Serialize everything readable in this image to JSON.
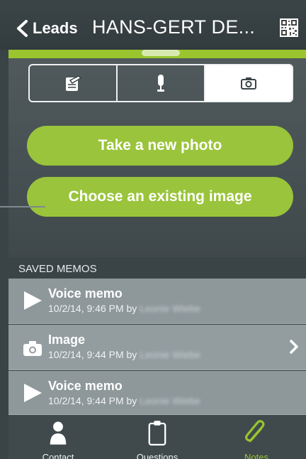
{
  "header": {
    "back_label": "Leads",
    "title": "HANS-GERT DE..."
  },
  "media_tabs": [
    "notes-icon",
    "microphone-icon",
    "camera-icon"
  ],
  "actions": {
    "take_photo": "Take a new photo",
    "choose_image": "Choose an existing image"
  },
  "saved_memos": {
    "header": "SAVED MEMOS",
    "items": [
      {
        "type": "voice",
        "title": "Voice memo",
        "meta": "10/2/14, 9:46 PM by",
        "author": "Leonie Wiebe",
        "icon": "play-icon"
      },
      {
        "type": "image",
        "title": "Image",
        "meta": "10/2/14, 9:44 PM by",
        "author": "Leonie Wiebe",
        "icon": "camera-icon"
      },
      {
        "type": "voice",
        "title": "Voice memo",
        "meta": "10/2/14, 9:44 PM by",
        "author": "Leonie Wiebe",
        "icon": "play-icon"
      }
    ]
  },
  "tabbar": {
    "contact": "Contact",
    "questions": "Questions",
    "notes": "Notes"
  },
  "colors": {
    "accent": "#9ac52f",
    "background": "#3a4446",
    "memo_row": "#8e989b"
  }
}
